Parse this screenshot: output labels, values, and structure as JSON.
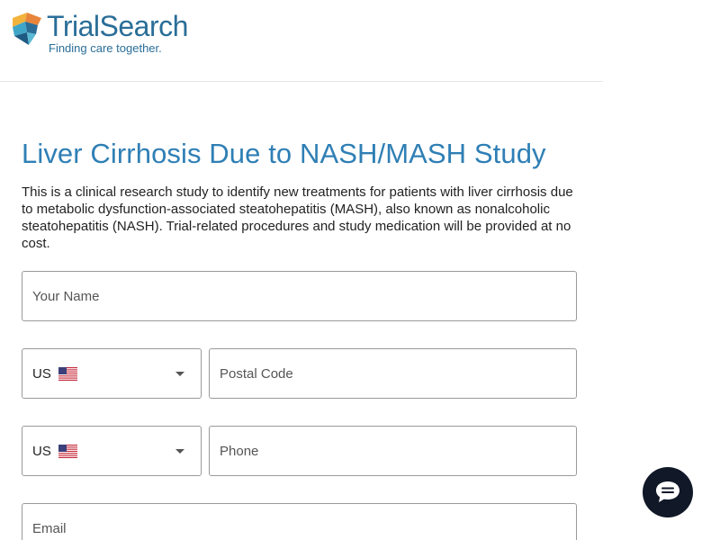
{
  "brand": {
    "name": "TrialSearch",
    "tagline": "Finding care together."
  },
  "study": {
    "title": "Liver Cirrhosis Due to NASH/MASH Study",
    "description": "This is a clinical research study to identify new treatments for patients with liver cirrhosis due to metabolic dysfunction-associated steatohepatitis (MASH), also known as nonalcoholic steatohepatitis (NASH). Trial-related procedures and study medication will be provided at no cost."
  },
  "form": {
    "name_placeholder": "Your Name",
    "postal_country": {
      "code": "US",
      "flag": "us-flag-icon"
    },
    "postal_placeholder": "Postal Code",
    "phone_country": {
      "code": "US",
      "flag": "us-flag-icon"
    },
    "phone_placeholder": "Phone",
    "email_placeholder": "Email"
  },
  "chat": {
    "icon": "chat-bubble-icon"
  },
  "colors": {
    "brand_blue": "#2a6e98",
    "title_blue": "#2f7fb5",
    "chat_bg": "#111827"
  }
}
